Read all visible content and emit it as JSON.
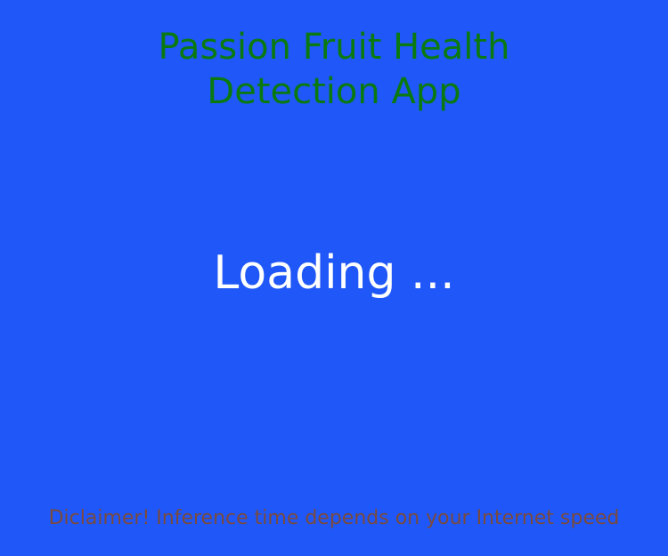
{
  "app": {
    "title_line_1": "Passion Fruit Health",
    "title_line_2": "Detection App"
  },
  "status": {
    "loading_text": "Loading ..."
  },
  "footer": {
    "disclaimer": "Diclaimer! Inference time depends on your Internet speed"
  },
  "colors": {
    "background": "#1f57f8",
    "title": "#0a7a10",
    "loading_text": "#ffffff",
    "disclaimer": "#7a4a3c"
  }
}
